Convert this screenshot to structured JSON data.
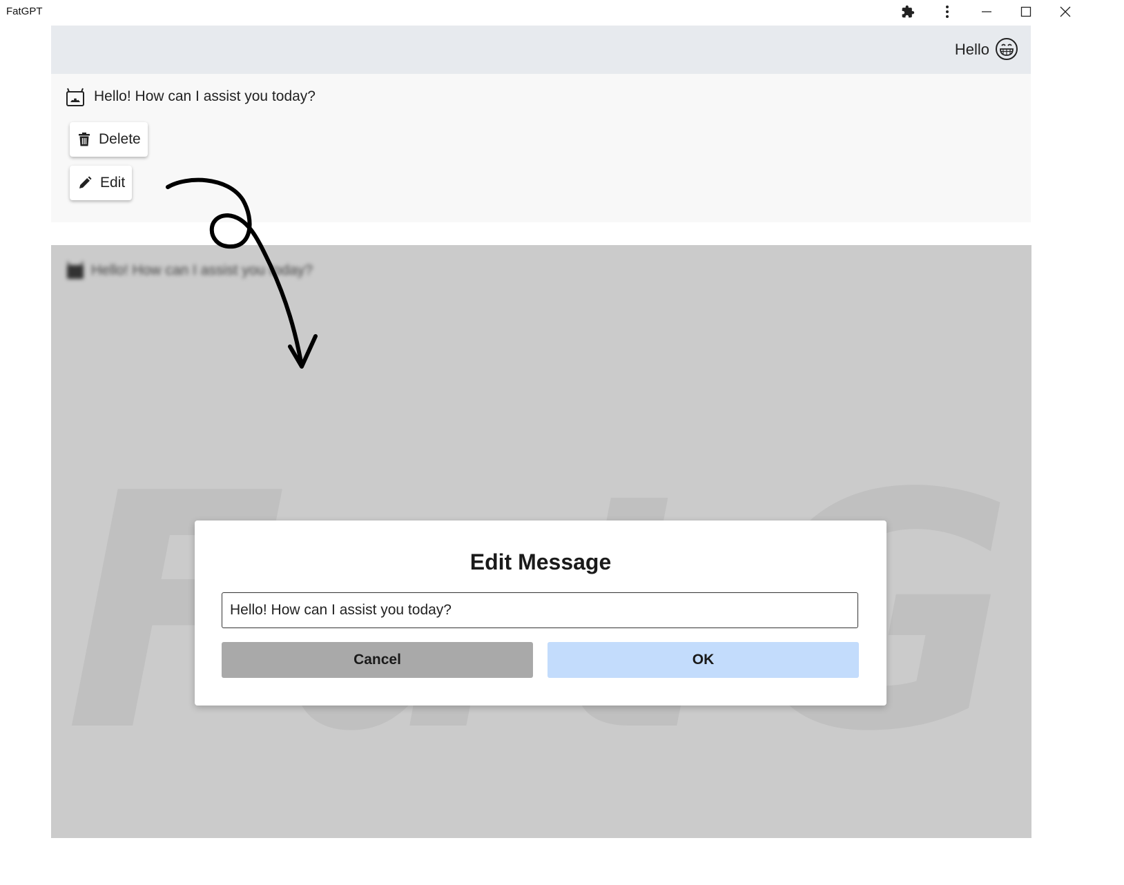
{
  "window": {
    "title": "FatGPT",
    "controls": {
      "extensions_icon": "puzzle-icon",
      "menu_icon": "kebab-menu-icon",
      "minimize_icon": "minimize-icon",
      "maximize_icon": "maximize-icon",
      "close_icon": "close-icon"
    }
  },
  "header": {
    "greeting": "Hello",
    "avatar_icon": "grinning-face-icon",
    "background": "#e7eaee"
  },
  "chat": {
    "message": {
      "icon": "robot-icon",
      "text": "Hello! How can I assist you today?"
    },
    "actions": {
      "delete_label": "Delete",
      "delete_icon": "trash-icon",
      "edit_label": "Edit",
      "edit_icon": "pencil-icon"
    }
  },
  "background_view": {
    "message_text": "Hello! How can I assist you today?",
    "watermark": "FatGPT"
  },
  "modal": {
    "title": "Edit Message",
    "input_value": "Hello! How can I assist you today?",
    "cancel_label": "Cancel",
    "ok_label": "OK",
    "colors": {
      "cancel": "#a9a9a9",
      "ok": "#c3dcfc"
    }
  }
}
